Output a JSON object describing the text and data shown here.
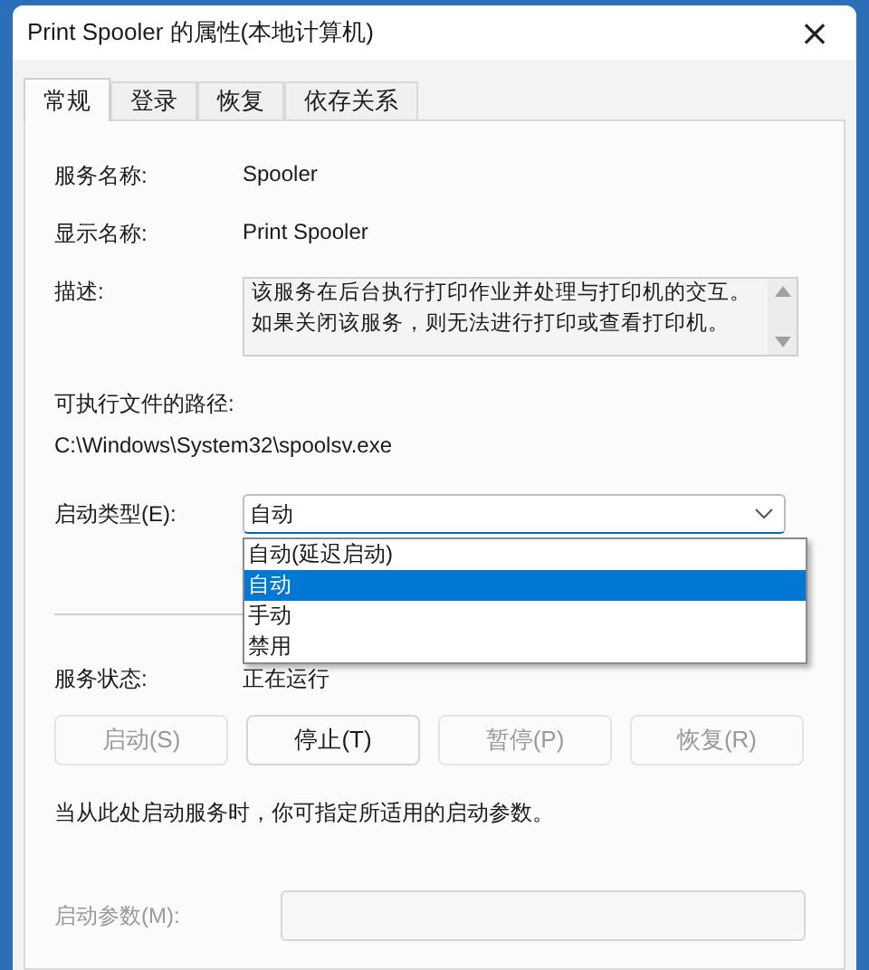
{
  "window": {
    "title": "Print Spooler 的属性(本地计算机)",
    "close": "×"
  },
  "tabs": [
    {
      "label": "常规",
      "selected": true
    },
    {
      "label": "登录",
      "selected": false
    },
    {
      "label": "恢复",
      "selected": false
    },
    {
      "label": "依存关系",
      "selected": false
    }
  ],
  "service_name": {
    "label": "服务名称:",
    "value": "Spooler"
  },
  "display_name": {
    "label": "显示名称:",
    "value": "Print Spooler"
  },
  "description": {
    "label": "描述:",
    "value": "该服务在后台执行打印作业并处理与打印机的交互。如果关闭该服务，则无法进行打印或查看打印机。"
  },
  "executable_path": {
    "label": "可执行文件的路径:",
    "value": "C:\\Windows\\System32\\spoolsv.exe"
  },
  "startup_type": {
    "label": "启动类型(E):",
    "value": "自动",
    "expanded": true,
    "options": [
      {
        "label": "自动(延迟启动)",
        "selected": false
      },
      {
        "label": "自动",
        "selected": true
      },
      {
        "label": "手动",
        "selected": false
      },
      {
        "label": "禁用",
        "selected": false
      }
    ]
  },
  "service_status": {
    "label": "服务状态:",
    "value": "正在运行"
  },
  "buttons": [
    {
      "label": "启动(S)",
      "disabled": true
    },
    {
      "label": "停止(T)",
      "disabled": false
    },
    {
      "label": "暂停(P)",
      "disabled": true
    },
    {
      "label": "恢复(R)",
      "disabled": true
    }
  ],
  "hint": "当从此处启动服务时，你可指定所适用的启动参数。",
  "start_parameters": {
    "label": "启动参数(M):",
    "disabled": true
  }
}
